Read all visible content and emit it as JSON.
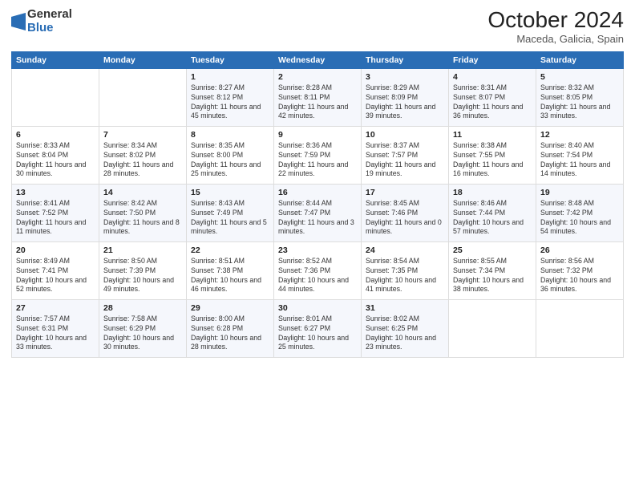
{
  "logo": {
    "general": "General",
    "blue": "Blue"
  },
  "header": {
    "month": "October 2024",
    "location": "Maceda, Galicia, Spain"
  },
  "weekdays": [
    "Sunday",
    "Monday",
    "Tuesday",
    "Wednesday",
    "Thursday",
    "Friday",
    "Saturday"
  ],
  "weeks": [
    [
      {
        "day": "",
        "info": ""
      },
      {
        "day": "",
        "info": ""
      },
      {
        "day": "1",
        "info": "Sunrise: 8:27 AM\nSunset: 8:12 PM\nDaylight: 11 hours and 45 minutes."
      },
      {
        "day": "2",
        "info": "Sunrise: 8:28 AM\nSunset: 8:11 PM\nDaylight: 11 hours and 42 minutes."
      },
      {
        "day": "3",
        "info": "Sunrise: 8:29 AM\nSunset: 8:09 PM\nDaylight: 11 hours and 39 minutes."
      },
      {
        "day": "4",
        "info": "Sunrise: 8:31 AM\nSunset: 8:07 PM\nDaylight: 11 hours and 36 minutes."
      },
      {
        "day": "5",
        "info": "Sunrise: 8:32 AM\nSunset: 8:05 PM\nDaylight: 11 hours and 33 minutes."
      }
    ],
    [
      {
        "day": "6",
        "info": "Sunrise: 8:33 AM\nSunset: 8:04 PM\nDaylight: 11 hours and 30 minutes."
      },
      {
        "day": "7",
        "info": "Sunrise: 8:34 AM\nSunset: 8:02 PM\nDaylight: 11 hours and 28 minutes."
      },
      {
        "day": "8",
        "info": "Sunrise: 8:35 AM\nSunset: 8:00 PM\nDaylight: 11 hours and 25 minutes."
      },
      {
        "day": "9",
        "info": "Sunrise: 8:36 AM\nSunset: 7:59 PM\nDaylight: 11 hours and 22 minutes."
      },
      {
        "day": "10",
        "info": "Sunrise: 8:37 AM\nSunset: 7:57 PM\nDaylight: 11 hours and 19 minutes."
      },
      {
        "day": "11",
        "info": "Sunrise: 8:38 AM\nSunset: 7:55 PM\nDaylight: 11 hours and 16 minutes."
      },
      {
        "day": "12",
        "info": "Sunrise: 8:40 AM\nSunset: 7:54 PM\nDaylight: 11 hours and 14 minutes."
      }
    ],
    [
      {
        "day": "13",
        "info": "Sunrise: 8:41 AM\nSunset: 7:52 PM\nDaylight: 11 hours and 11 minutes."
      },
      {
        "day": "14",
        "info": "Sunrise: 8:42 AM\nSunset: 7:50 PM\nDaylight: 11 hours and 8 minutes."
      },
      {
        "day": "15",
        "info": "Sunrise: 8:43 AM\nSunset: 7:49 PM\nDaylight: 11 hours and 5 minutes."
      },
      {
        "day": "16",
        "info": "Sunrise: 8:44 AM\nSunset: 7:47 PM\nDaylight: 11 hours and 3 minutes."
      },
      {
        "day": "17",
        "info": "Sunrise: 8:45 AM\nSunset: 7:46 PM\nDaylight: 11 hours and 0 minutes."
      },
      {
        "day": "18",
        "info": "Sunrise: 8:46 AM\nSunset: 7:44 PM\nDaylight: 10 hours and 57 minutes."
      },
      {
        "day": "19",
        "info": "Sunrise: 8:48 AM\nSunset: 7:42 PM\nDaylight: 10 hours and 54 minutes."
      }
    ],
    [
      {
        "day": "20",
        "info": "Sunrise: 8:49 AM\nSunset: 7:41 PM\nDaylight: 10 hours and 52 minutes."
      },
      {
        "day": "21",
        "info": "Sunrise: 8:50 AM\nSunset: 7:39 PM\nDaylight: 10 hours and 49 minutes."
      },
      {
        "day": "22",
        "info": "Sunrise: 8:51 AM\nSunset: 7:38 PM\nDaylight: 10 hours and 46 minutes."
      },
      {
        "day": "23",
        "info": "Sunrise: 8:52 AM\nSunset: 7:36 PM\nDaylight: 10 hours and 44 minutes."
      },
      {
        "day": "24",
        "info": "Sunrise: 8:54 AM\nSunset: 7:35 PM\nDaylight: 10 hours and 41 minutes."
      },
      {
        "day": "25",
        "info": "Sunrise: 8:55 AM\nSunset: 7:34 PM\nDaylight: 10 hours and 38 minutes."
      },
      {
        "day": "26",
        "info": "Sunrise: 8:56 AM\nSunset: 7:32 PM\nDaylight: 10 hours and 36 minutes."
      }
    ],
    [
      {
        "day": "27",
        "info": "Sunrise: 7:57 AM\nSunset: 6:31 PM\nDaylight: 10 hours and 33 minutes."
      },
      {
        "day": "28",
        "info": "Sunrise: 7:58 AM\nSunset: 6:29 PM\nDaylight: 10 hours and 30 minutes."
      },
      {
        "day": "29",
        "info": "Sunrise: 8:00 AM\nSunset: 6:28 PM\nDaylight: 10 hours and 28 minutes."
      },
      {
        "day": "30",
        "info": "Sunrise: 8:01 AM\nSunset: 6:27 PM\nDaylight: 10 hours and 25 minutes."
      },
      {
        "day": "31",
        "info": "Sunrise: 8:02 AM\nSunset: 6:25 PM\nDaylight: 10 hours and 23 minutes."
      },
      {
        "day": "",
        "info": ""
      },
      {
        "day": "",
        "info": ""
      }
    ]
  ]
}
